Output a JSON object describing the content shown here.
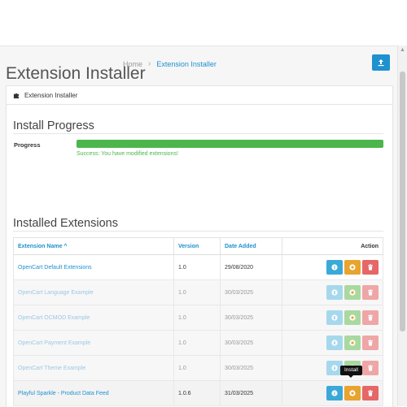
{
  "header": {
    "title": "Extension Installer",
    "breadcrumb": {
      "home": "Home",
      "separator": "›",
      "current": "Extension Installer"
    },
    "upload_icon": "upload-icon"
  },
  "panel": {
    "heading": "Extension Installer",
    "heading_icon": "puzzle-icon"
  },
  "progress": {
    "section_title": "Install Progress",
    "label": "Progress",
    "percent": 100,
    "message": "Success: You have modified extensions!"
  },
  "extensions": {
    "section_title": "Installed Extensions",
    "columns": {
      "name": "Extension Name ^",
      "version": "Version",
      "date": "Date Added",
      "action": "Action"
    },
    "rows": [
      {
        "name": "OpenCart Default Extensions",
        "version": "1.0",
        "date": "29/08/2020",
        "state": "normal"
      },
      {
        "name": "OpenCart Language Example",
        "version": "1.0",
        "date": "30/03/2025",
        "state": "faded"
      },
      {
        "name": "OpenCart OCMOD Example",
        "version": "1.0",
        "date": "30/03/2025",
        "state": "faded"
      },
      {
        "name": "OpenCart Payment Example",
        "version": "1.0",
        "date": "30/03/2025",
        "state": "faded"
      },
      {
        "name": "OpenCart Theme Example",
        "version": "1.0",
        "date": "30/03/2025",
        "state": "faded"
      },
      {
        "name": "Playful Sparkle - Product Data Feed",
        "version": "1.0.6",
        "date": "31/03/2025",
        "state": "active"
      }
    ]
  },
  "tooltip": "Install",
  "colors": {
    "primary": "#1e91cf",
    "success": "#4cb64c",
    "warning": "#e8a42e",
    "danger": "#e56767",
    "info": "#3ba9d7"
  }
}
